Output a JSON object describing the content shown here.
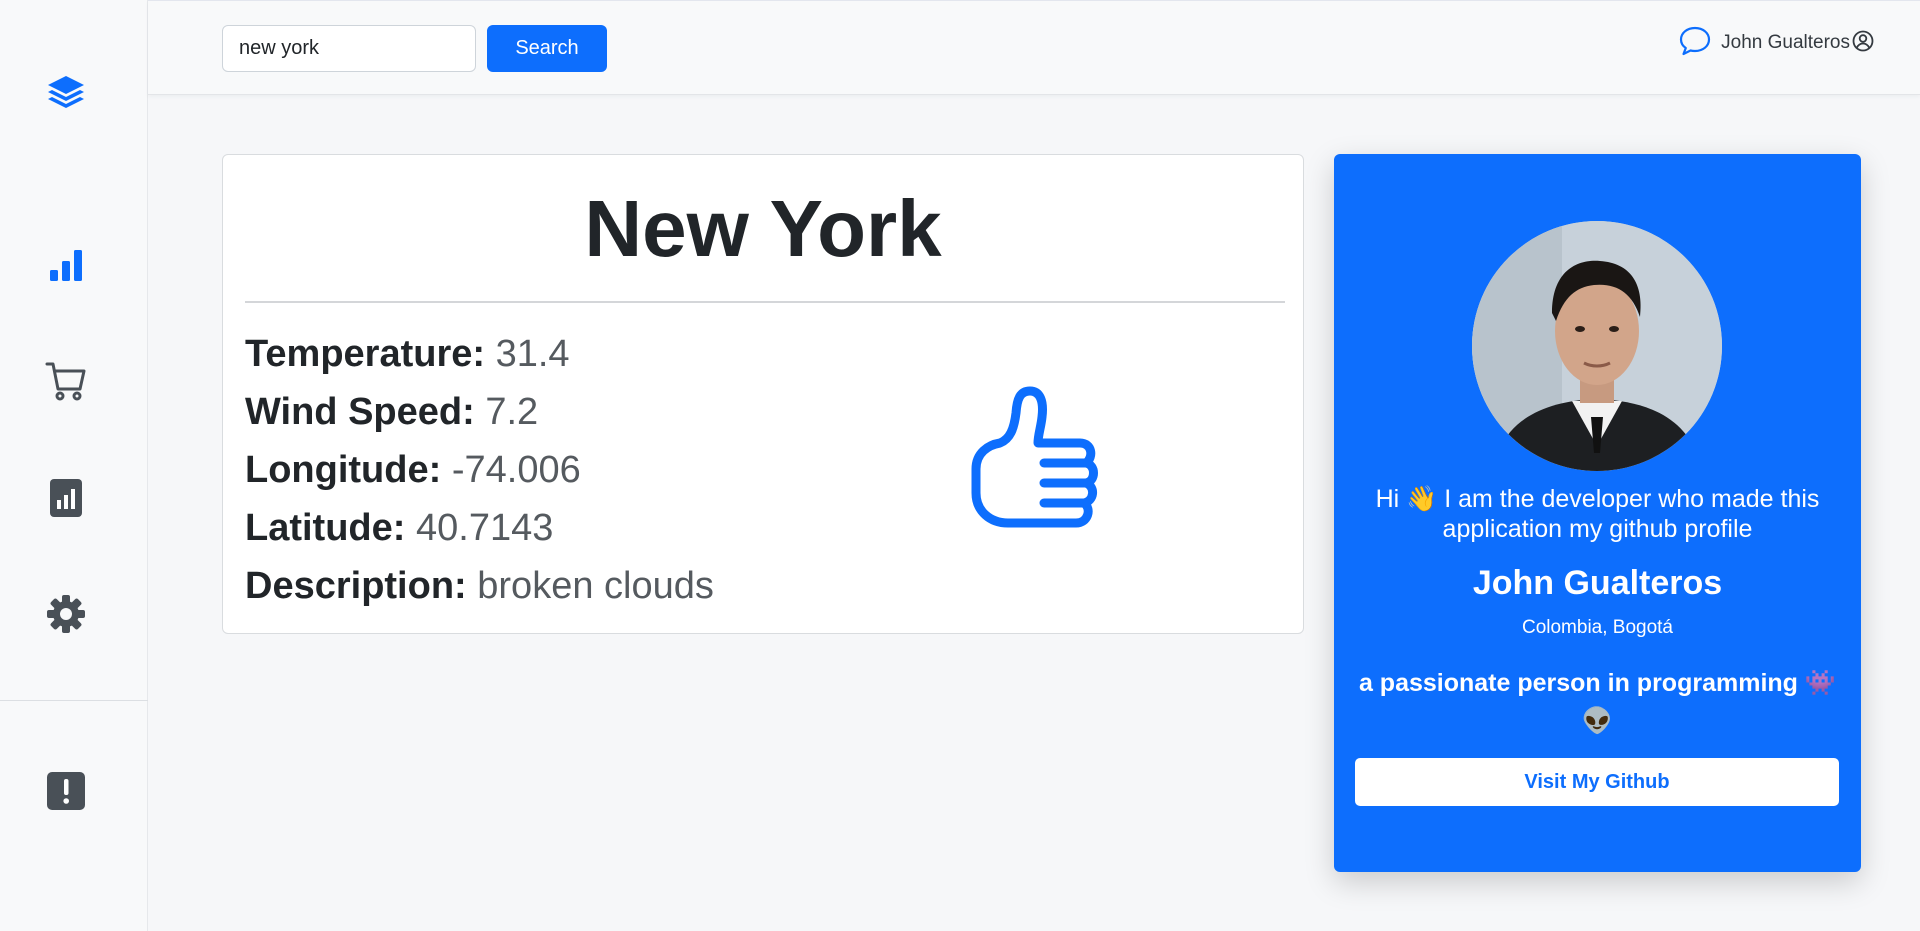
{
  "sidebar": {
    "icons": [
      "layers-icon",
      "bar-chart-icon",
      "cart-icon",
      "report-icon",
      "gear-icon",
      "alert-icon"
    ],
    "accent": "#0d6efd",
    "muted": "#495057"
  },
  "topbar": {
    "search_value": "new york",
    "search_button": "Search",
    "user_name": "John Gualteros",
    "icons": [
      "chat-icon",
      "user-circle-icon"
    ]
  },
  "weather": {
    "city": "New York",
    "fields": [
      {
        "label": "Temperature:",
        "value": "31.4"
      },
      {
        "label": "Wind Speed:",
        "value": "7.2"
      },
      {
        "label": "Longitude:",
        "value": "-74.006"
      },
      {
        "label": "Latitude:",
        "value": "40.7143"
      },
      {
        "label": "Description:",
        "value": "broken clouds"
      }
    ],
    "status_icon": "thumbs-up-icon"
  },
  "profile": {
    "intro_prefix": "Hi ",
    "intro_emoji": "👋",
    "intro_text": " I am the developer who made this application my github profile",
    "name": "John Gualteros",
    "location": "Colombia, Bogotá",
    "passion": "a passionate person in programming",
    "passion_emoji_1": "👾",
    "passion_emoji_2": "👽",
    "button": "Visit My Github",
    "bg_color": "#0d6efd"
  }
}
